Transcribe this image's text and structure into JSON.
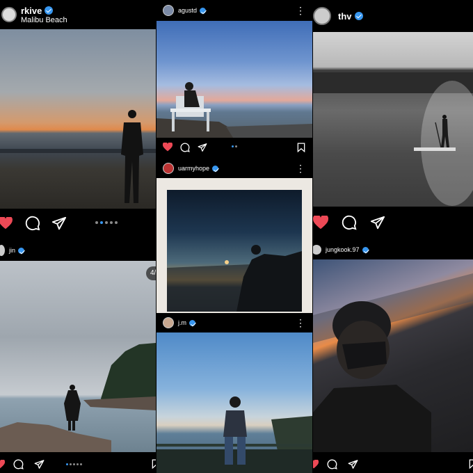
{
  "posts": {
    "rkive": {
      "username": "rkive",
      "location": "Malibu Beach",
      "carousel_count": 5,
      "carousel_active": 2
    },
    "agustd": {
      "username": "agustd",
      "carousel_count": 2,
      "carousel_active": 1
    },
    "thv": {
      "username": "thv"
    },
    "uarmyhope": {
      "username": "uarmyhope"
    },
    "jin": {
      "username": "jin",
      "counter": "4/"
    },
    "jm": {
      "username": "j.m"
    },
    "jungkook": {
      "username": "jungkook.97"
    },
    "bottom_left": {
      "carousel_count": 5,
      "carousel_active": 1
    }
  },
  "icons": [
    "heart-icon",
    "comment-icon",
    "share-icon",
    "bookmark-icon",
    "more-icon",
    "verified-icon"
  ],
  "colors": {
    "like_red": "#ed4956",
    "verified_blue": "#3897f0",
    "background": "#000000"
  }
}
